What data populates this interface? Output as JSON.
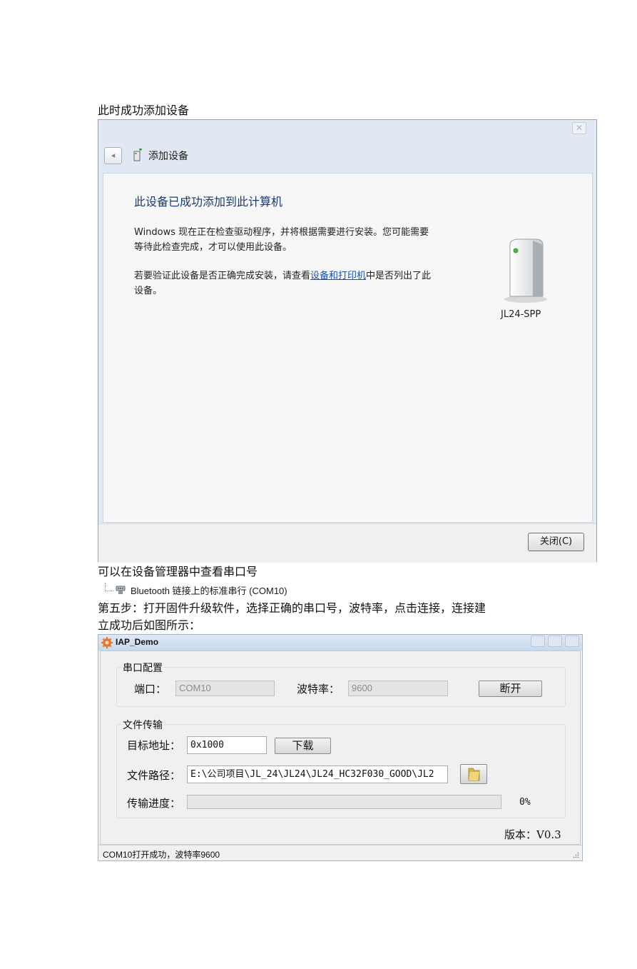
{
  "doc": {
    "line1": "此时成功添加设备",
    "line2": "可以在设备管理器中查看串口号",
    "line3": "第五步：打开固件升级软件，选择正确的串口号，波特率，点击连接，连接建",
    "line4": "立成功后如图所示："
  },
  "wizard": {
    "title": "添加设备",
    "heading": "此设备已成功添加到此计算机",
    "para1": "Windows 现在正在检查驱动程序，并将根据需要进行安装。您可能需要等待此检查完成，才可以使用此设备。",
    "para2_before": "若要验证此设备是否正确完成安装，请查看",
    "para2_link": "设备和打印机",
    "para2_after": "中是否列出了此设备。",
    "device_name": "JL24-SPP",
    "close_button": "关闭(C)",
    "icons": [
      "back-arrow-icon",
      "device-add-icon",
      "tower-device-icon",
      "window-close-icon"
    ]
  },
  "device_manager": {
    "port_label": "Bluetooth 链接上的标准串行 (COM10)",
    "icon": "serial-port-icon"
  },
  "iap": {
    "title": "IAP_Demo",
    "serial_group": "串口配置",
    "port_label": "端口：",
    "port_value": "COM10",
    "baud_label": "波特率：",
    "baud_value": "9600",
    "disconnect_button": "断开",
    "file_group": "文件传输",
    "addr_label": "目标地址：",
    "addr_value": "0x1000",
    "download_button": "下载",
    "path_label": "文件路径：",
    "path_value": "E:\\公司项目\\JL_24\\JL24\\JL24_HC32F030_GOOD\\JL2",
    "progress_label": "传输进度：",
    "progress_value": 0,
    "progress_text": "0%",
    "version": "版本：V0.3",
    "status": "COM10打开成功，波特率9600",
    "icons": [
      "gear-app-icon",
      "folder-icon",
      "resize-grip-icon"
    ]
  }
}
